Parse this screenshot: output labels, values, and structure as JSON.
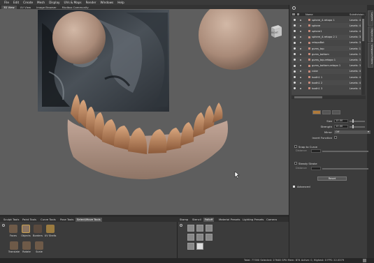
{
  "menu": [
    "File",
    "Edit",
    "Create",
    "Mesh",
    "Display",
    "UVs & Maps",
    "Render",
    "Windows",
    "Help"
  ],
  "mode_tabs": [
    {
      "label": "3D View",
      "active": true
    },
    {
      "label": "UV View",
      "active": false
    },
    {
      "label": "Image Browser",
      "active": false
    },
    {
      "label": "Mudbox Community",
      "active": false
    }
  ],
  "viewcube": {
    "label": "RIGHT"
  },
  "side_tabs": [
    "Layers",
    "Object List",
    "Viewport Filters"
  ],
  "scene": {
    "headers": {
      "name": "Name",
      "subdiv": "Subdivision"
    },
    "rows": [
      {
        "name": "sphere_4-retopo 1",
        "level": "Levels: 4"
      },
      {
        "name": "sphere",
        "level": "Levels: 4"
      },
      {
        "name": "sphere1",
        "level": "Levels: 4"
      },
      {
        "name": "sphere_4-retopo 2 1",
        "level": "Levels: 3"
      },
      {
        "name": "retopoBot",
        "level": "Levels: 3"
      },
      {
        "name": "gums_top",
        "level": "Levels: 1"
      },
      {
        "name": "gums_bottom",
        "level": "Levels: 1"
      },
      {
        "name": "gums_top-retopo 1",
        "level": "Levels: 3"
      },
      {
        "name": "gums_bottom-retopo 1",
        "level": "Levels: 3"
      },
      {
        "name": "cube",
        "level": "Levels: 4"
      },
      {
        "name": "tooth1 1",
        "level": "Levels: 4"
      },
      {
        "name": "tooth1 2",
        "level": "Levels: 4"
      },
      {
        "name": "tooth1 3",
        "level": "Levels: 4"
      }
    ]
  },
  "tool_properties": {
    "size": {
      "label": "Size",
      "value": "10.00"
    },
    "strength": {
      "label": "Strength",
      "value": "10.00"
    },
    "mirror": {
      "label": "Mirror",
      "value": "Off"
    },
    "invert": {
      "label": "Invert Function"
    },
    "snap": {
      "label": "Snap to Curve",
      "field": "Distance"
    },
    "steady": {
      "label": "Steady Stroke",
      "field": "Distance"
    },
    "reset_label": "Reset",
    "advanced_label": "Advanced"
  },
  "bottom_tabs": [
    {
      "label": "Sculpt Tools",
      "active": false
    },
    {
      "label": "Paint Tools",
      "active": false
    },
    {
      "label": "Curve Tools",
      "active": false
    },
    {
      "label": "Pose Tools",
      "active": false
    },
    {
      "label": "Select/Move Tools",
      "active": true
    },
    {
      "label": "Stamp",
      "active": false
    },
    {
      "label": "Stencil",
      "active": false
    },
    {
      "label": "Falloff",
      "active": true
    },
    {
      "label": "Material Presets",
      "active": false
    },
    {
      "label": "Lighting Presets",
      "active": false
    },
    {
      "label": "Camera Bookmarks",
      "active": false
    }
  ],
  "select_tools": [
    {
      "label": "Faces"
    },
    {
      "label": "Objects"
    },
    {
      "label": "Borders"
    },
    {
      "label": "UV Shells"
    },
    {
      "label": "Translate"
    },
    {
      "label": "Rotate"
    },
    {
      "label": "Scale"
    }
  ],
  "status": {
    "text": "Total: 77350  Selected: 27648  GPU Mem: 874  Active: 0, Highest: 0  FPS: 22.0379"
  },
  "colors": {
    "accent": "#b07a3a",
    "clay": "#b19383",
    "viewport_bg": "#5e5e5e"
  }
}
